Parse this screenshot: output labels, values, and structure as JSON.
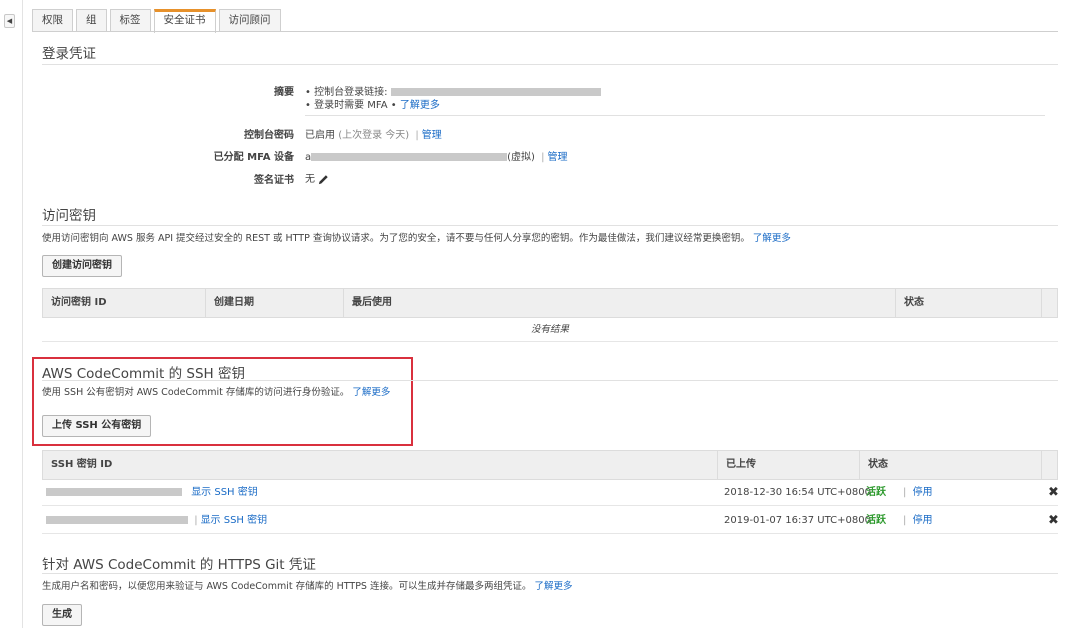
{
  "tabs": [
    "权限",
    "组",
    "标签",
    "安全证书",
    "访问顾问"
  ],
  "active_tab_index": 3,
  "login_credentials": {
    "title": "登录凭证",
    "summary_label": "摘要",
    "summary_line1_prefix": "• 控制台登录链接:",
    "summary_line2_prefix": "• 登录时需要 MFA • ",
    "summary_learn_more": "了解更多",
    "console_password_label": "控制台密码",
    "console_password_value": "已启用",
    "console_password_note": "(上次登录 今天)",
    "console_password_separator": "|",
    "console_password_manage": "管理",
    "mfa_label": "已分配 MFA 设备",
    "mfa_prefix": "a",
    "mfa_suffix": "(虚拟)",
    "mfa_separator": "|",
    "mfa_manage": "管理",
    "signing_cert_label": "签名证书",
    "signing_cert_value": "无"
  },
  "access_keys": {
    "title": "访问密钥",
    "description": "使用访问密钥向 AWS 服务 API 提交经过安全的 REST 或 HTTP 查询协议请求。为了您的安全，请不要与任何人分享您的密钥。作为最佳做法，我们建议经常更换密钥。",
    "learn_more": "了解更多",
    "create_button": "创建访问密钥",
    "columns": [
      "访问密钥 ID",
      "创建日期",
      "最后使用",
      "状态"
    ],
    "empty_text": "没有结果"
  },
  "ssh_keys": {
    "title": "AWS CodeCommit 的 SSH 密钥",
    "description": "使用 SSH 公有密钥对 AWS CodeCommit 存储库的访问进行身份验证。",
    "learn_more": "了解更多",
    "upload_button": "上传 SSH 公有密钥",
    "columns": [
      "SSH 密钥 ID",
      "已上传",
      "状态"
    ],
    "rows": [
      {
        "show_link": "显示 SSH 密钥",
        "separator": "",
        "uploaded": "2018-12-30 16:54 UTC+0800",
        "status": "活跃",
        "action_separator": "|",
        "action": "停用"
      },
      {
        "show_link": "显示 SSH 密钥",
        "separator": "|",
        "uploaded": "2019-01-07 16:37 UTC+0800",
        "status": "活跃",
        "action_separator": "|",
        "action": "停用"
      }
    ]
  },
  "https_git": {
    "title": "针对 AWS CodeCommit 的 HTTPS Git 凭证",
    "description": "生成用户名和密码，以便您用来验证与 AWS CodeCommit 存储库的 HTTPS 连接。可以生成并存储最多两组凭证。",
    "learn_more": "了解更多",
    "generate_button": "生成"
  },
  "colors": {
    "accent_tab": "#e7912b",
    "link": "#1a6bc6",
    "active_status": "#2e9a2e",
    "highlight": "#d9303d"
  },
  "icons": {
    "collapse": "caret-left-icon",
    "edit": "pencil-icon",
    "delete": "close-x-icon"
  }
}
